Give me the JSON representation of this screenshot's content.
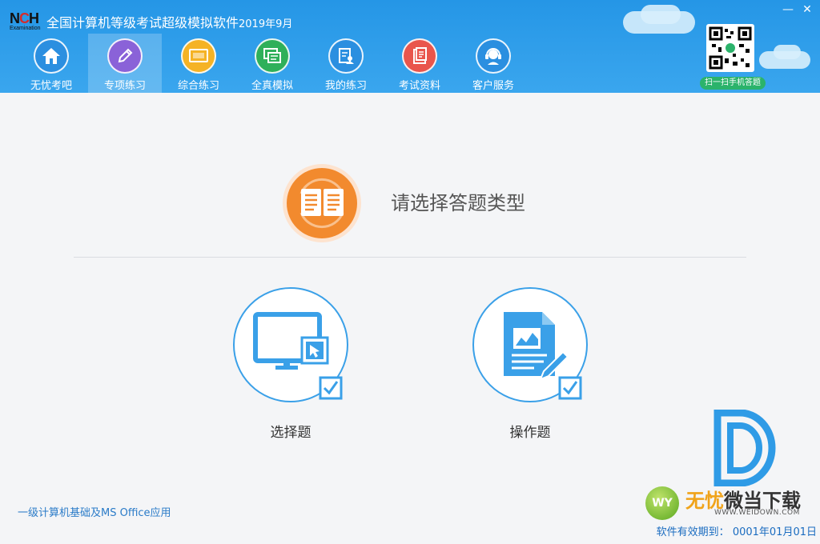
{
  "app": {
    "logo_text": "NCH",
    "logo_sub": "Examination",
    "title": "全国计算机等级考试超级模拟软件",
    "title_date": "2019年9月"
  },
  "window_controls": {
    "minimize": "—",
    "close": "✕"
  },
  "nav": {
    "items": [
      {
        "label": "无忧考吧",
        "icon": "home-icon",
        "color": "#2b8fe0",
        "active": false
      },
      {
        "label": "专项练习",
        "icon": "pencil-icon",
        "color": "#8a62d8",
        "active": true
      },
      {
        "label": "综合练习",
        "icon": "monitor-icon",
        "color": "#f5b325",
        "active": false
      },
      {
        "label": "全真模拟",
        "icon": "chat-icon",
        "color": "#2fb05a",
        "active": false
      },
      {
        "label": "我的练习",
        "icon": "profile-icon",
        "color": "#2b8fe0",
        "active": false
      },
      {
        "label": "考试资料",
        "icon": "document-icon",
        "color": "#e9554c",
        "active": false
      },
      {
        "label": "客户服务",
        "icon": "headset-icon",
        "color": "#2b8fe0",
        "active": false
      }
    ]
  },
  "qr": {
    "caption": "扫一扫手机答题"
  },
  "main": {
    "heading": "请选择答题类型",
    "choices": [
      {
        "label": "选择题"
      },
      {
        "label": "操作题"
      }
    ]
  },
  "footer": {
    "subject": "一级计算机基础及MS Office应用",
    "expiry_label": "软件有效期到：",
    "expiry_date": "0001年01月01日"
  },
  "watermark": {
    "badge": "WY",
    "text_a": "无忧",
    "text_b": "微当下载",
    "url": "WWW.WEIDOWN.COM"
  },
  "colors": {
    "header": "#2596e6",
    "accent_blue": "#2f9be6",
    "orange": "#f28a2e"
  }
}
